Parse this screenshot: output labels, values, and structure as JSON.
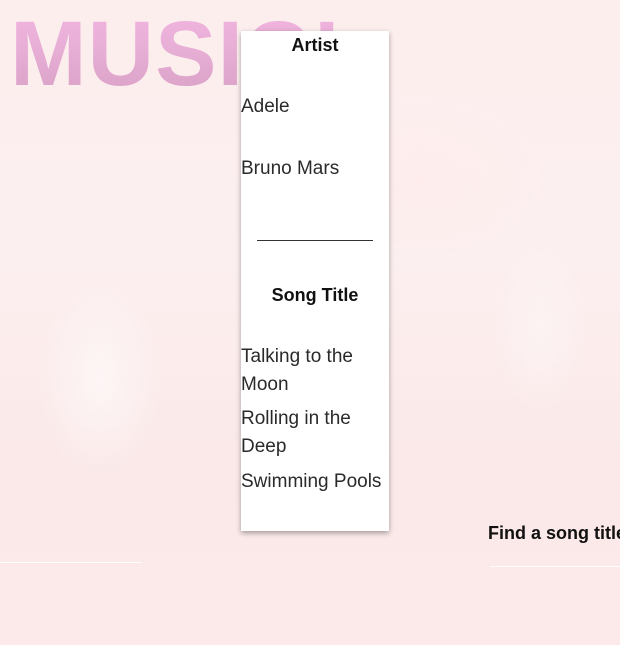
{
  "hero": {
    "title": "MUSIC!"
  },
  "table": {
    "artist_heading": "Artist",
    "artists": [
      "Adele",
      "Bruno Mars"
    ],
    "song_heading": "Song Title",
    "songs": [
      "Talking to the Moon",
      "Rolling in the Deep",
      "Swimming Pools"
    ]
  },
  "search": {
    "label": "Find a song title"
  }
}
